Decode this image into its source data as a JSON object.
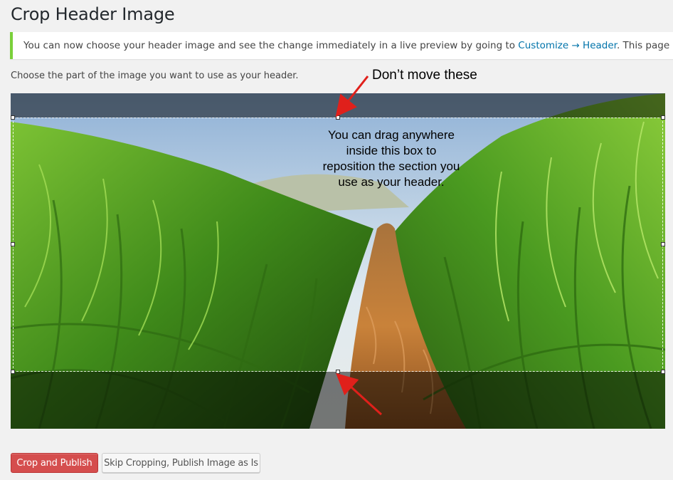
{
  "page": {
    "title": "Crop Header Image"
  },
  "notice": {
    "text_before": "You can now choose your header image and see the change immediately in a live preview by going to ",
    "link_text": "Customize → Header",
    "text_after": ". This page will automatically re"
  },
  "instructions": "Choose the part of the image you want to use as your header.",
  "annotations": {
    "top": "Don’t move these",
    "middle_lines": [
      "You can drag anywhere",
      "inside this box to",
      "reposition the section you",
      "use as your header."
    ]
  },
  "buttons": {
    "crop_publish": "Crop and Publish",
    "skip_cropping": "Skip Cropping, Publish Image as Is"
  },
  "colors": {
    "notice_border": "#7ad03a",
    "link": "#0073aa",
    "primary_button": "#d54e4e",
    "annotation_arrow": "#e0201b"
  }
}
